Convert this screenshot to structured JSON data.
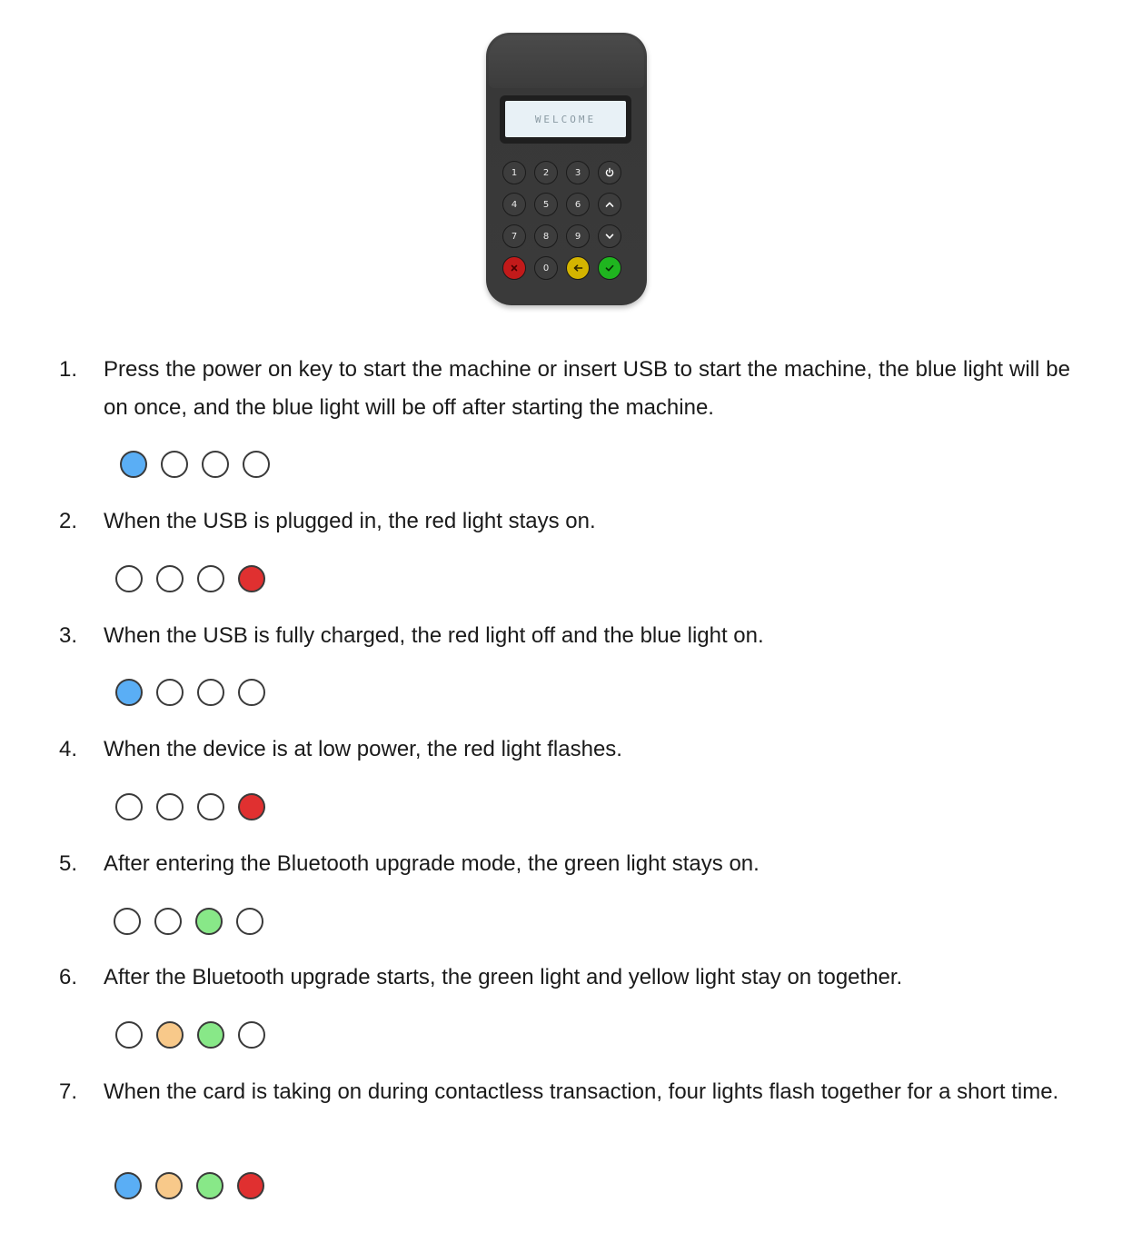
{
  "device": {
    "screen_text": "WELCOME",
    "keys": [
      [
        {
          "label": "1",
          "type": "num"
        },
        {
          "label": "2",
          "type": "num"
        },
        {
          "label": "3",
          "type": "num"
        },
        {
          "label": "",
          "type": "power",
          "icon": "power-icon"
        }
      ],
      [
        {
          "label": "4",
          "type": "num"
        },
        {
          "label": "5",
          "type": "num"
        },
        {
          "label": "6",
          "type": "num"
        },
        {
          "label": "",
          "type": "up",
          "icon": "chevron-up-icon"
        }
      ],
      [
        {
          "label": "7",
          "type": "num"
        },
        {
          "label": "8",
          "type": "num"
        },
        {
          "label": "9",
          "type": "num"
        },
        {
          "label": "",
          "type": "down",
          "icon": "chevron-down-icon"
        }
      ],
      [
        {
          "label": "",
          "type": "cancel",
          "icon": "cancel-x-icon"
        },
        {
          "label": "0",
          "type": "num"
        },
        {
          "label": "",
          "type": "back",
          "icon": "backspace-arrow-icon"
        },
        {
          "label": "",
          "type": "confirm",
          "icon": "confirm-check-icon"
        }
      ]
    ],
    "key_colors": {
      "cancel": "#c21a1a",
      "back": "#d4b400",
      "confirm": "#1fb51f"
    }
  },
  "light_colors": {
    "off": "#ffffff",
    "blue": "#5aaef5",
    "red": "#e03030",
    "green": "#88e888",
    "yellow": "#f8c98a"
  },
  "instructions": [
    {
      "number": "1.",
      "text": "Press the power on key to start the machine or insert USB to start the machine, the blue light will be on once, and the blue light will be off after starting the machine.",
      "lights": [
        "blue",
        "off",
        "off",
        "off"
      ]
    },
    {
      "number": "2.",
      "text": "When the USB is plugged in, the red light stays on.",
      "lights": [
        "off",
        "off",
        "off",
        "red"
      ]
    },
    {
      "number": "3.",
      "text": "When the USB is fully charged, the red light off and the blue light on.",
      "lights": [
        "blue",
        "off",
        "off",
        "off"
      ]
    },
    {
      "number": "4.",
      "text": "When the device is at low power, the red light flashes.",
      "lights": [
        "off",
        "off",
        "off",
        "red"
      ]
    },
    {
      "number": "5.",
      "text": "After entering the Bluetooth upgrade mode, the green light stays on.",
      "lights": [
        "off",
        "off",
        "green",
        "off"
      ]
    },
    {
      "number": "6.",
      "text": "After the Bluetooth upgrade starts, the green light and yellow light stay on together.",
      "lights": [
        "off",
        "yellow",
        "green",
        "off"
      ]
    },
    {
      "number": "7.",
      "text": "When the card is taking on during contactless transaction, four lights flash together for a short time.",
      "lights": [
        "blue",
        "yellow",
        "green",
        "red"
      ]
    }
  ]
}
